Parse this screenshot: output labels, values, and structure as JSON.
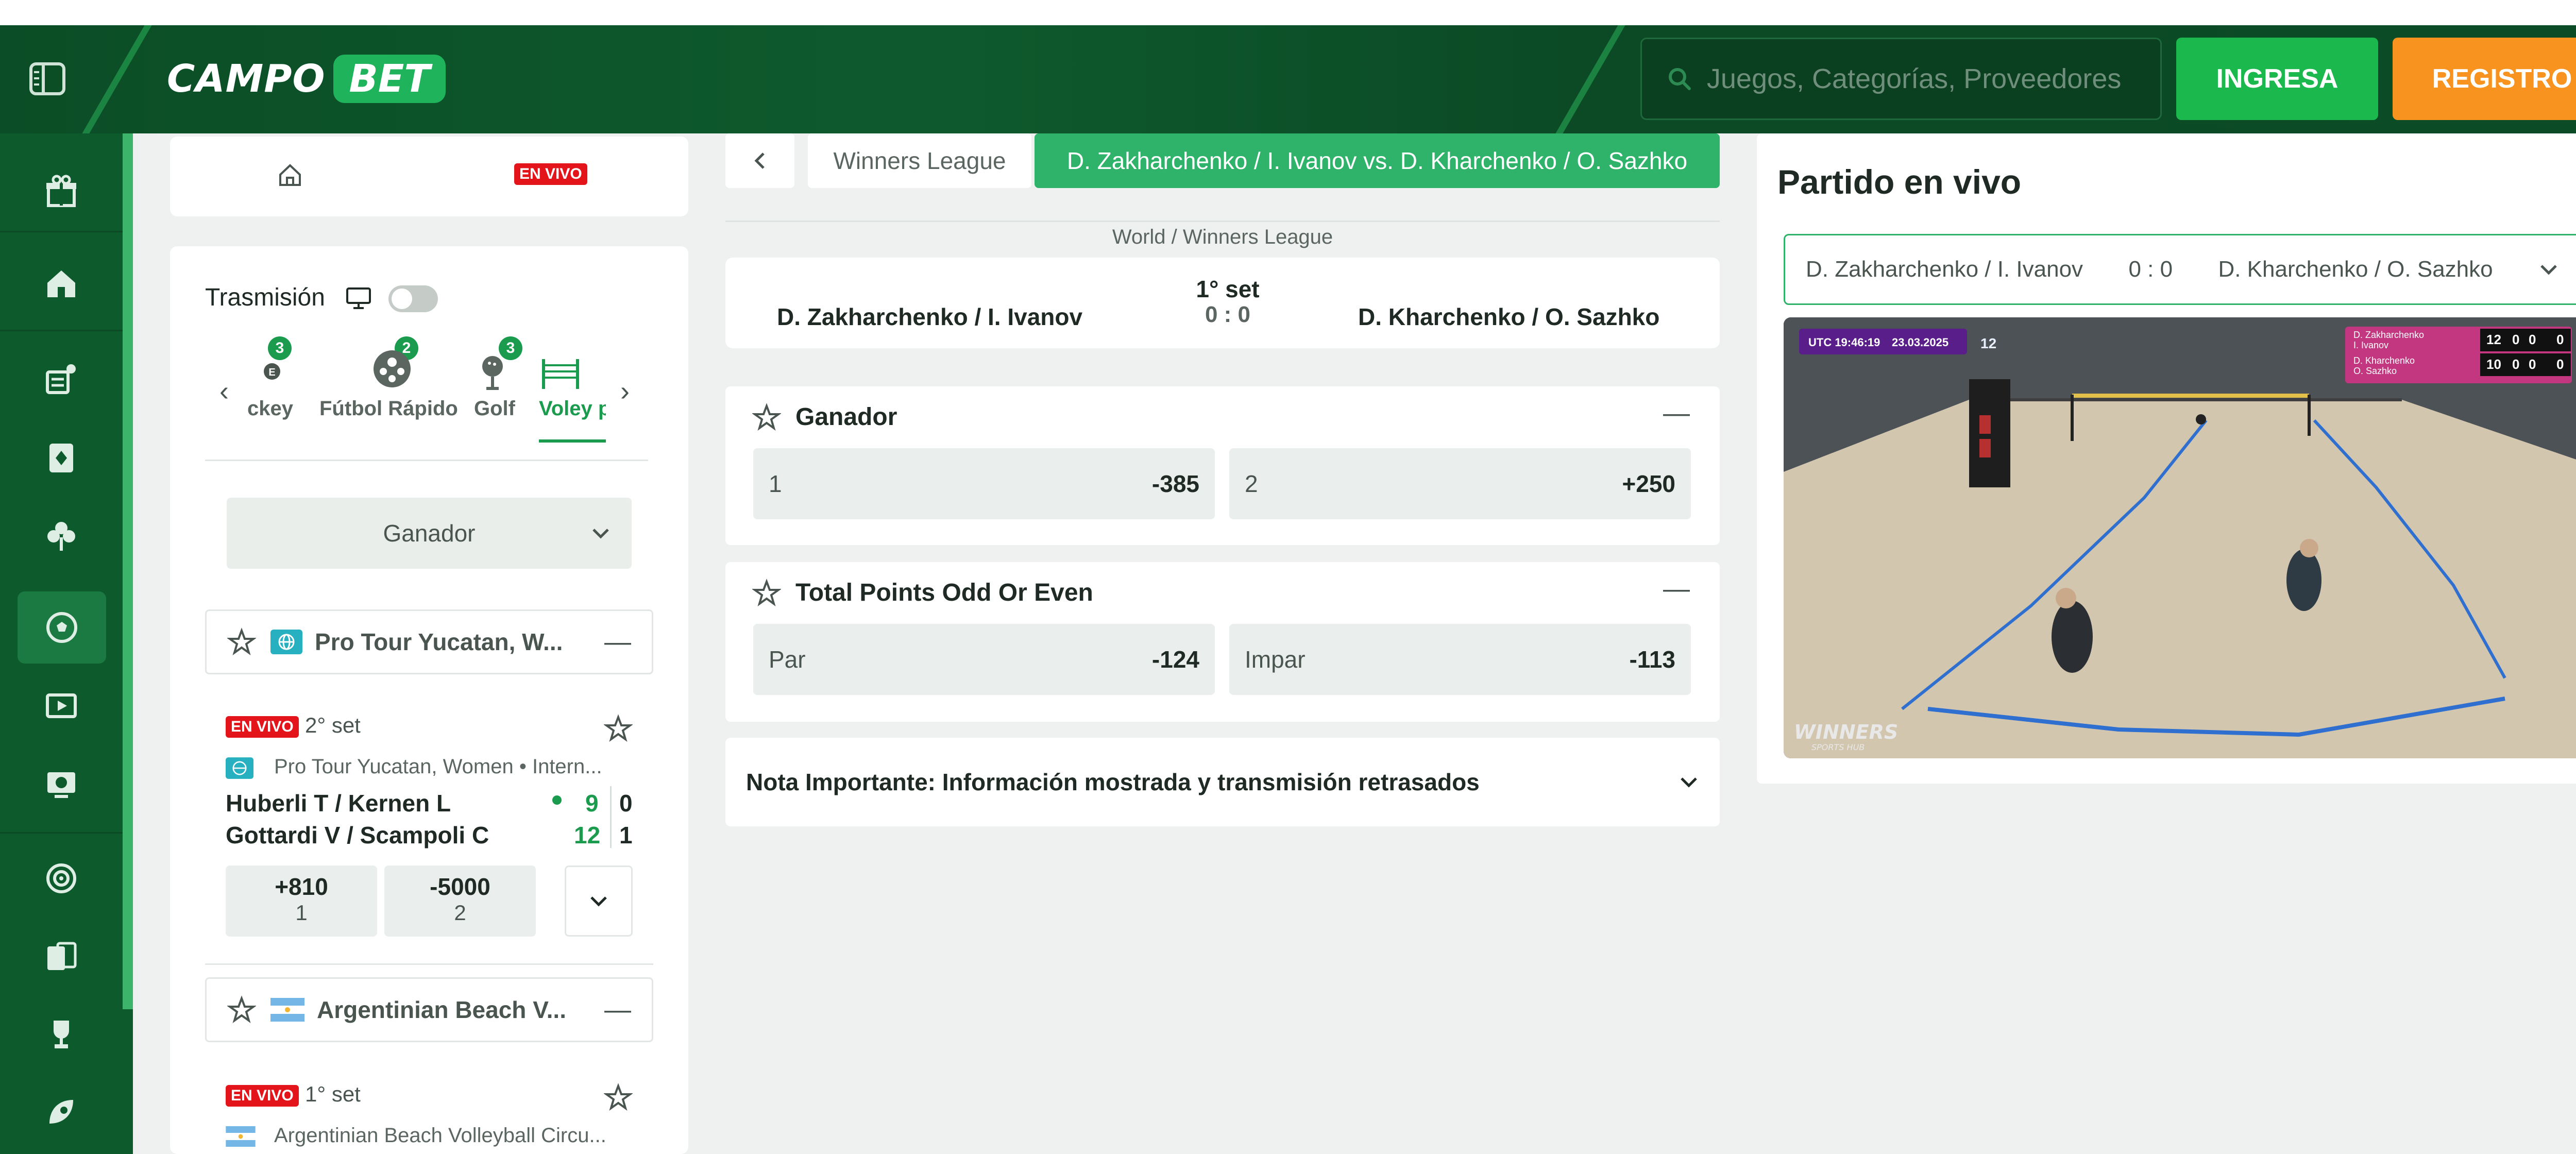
{
  "header": {
    "logo_left": "CAMPO",
    "logo_right": "BET",
    "search_placeholder": "Juegos, Categorías, Proveedores",
    "login_label": "INGRESA",
    "register_label": "REGISTRO"
  },
  "rail": {
    "icons": [
      "gift-icon",
      "home-icon",
      "sports-bet-icon",
      "casino-icon",
      "clover-icon",
      "soccer-ball-icon",
      "video-play-icon",
      "virtual-soccer-icon",
      "target-icon",
      "cards-icon",
      "trophy-icon",
      "rocket-icon"
    ]
  },
  "left": {
    "nav_live": "EN VIVO",
    "transmission_label": "Trasmisión",
    "sport_tabs": [
      {
        "label": "ckey",
        "count": "3"
      },
      {
        "label": "Fútbol Rápido",
        "count": "2"
      },
      {
        "label": "Golf",
        "count": "3"
      },
      {
        "label": "Voley p",
        "count": ""
      }
    ],
    "market_select": "Ganador",
    "leagues": [
      {
        "name": "Pro Tour Yucatan, W...",
        "events": [
          {
            "live": "EN VIVO",
            "period": "2° set",
            "subtitle": "Pro Tour Yucatan, Women • Intern...",
            "team1": "Huberli T / Kernen L",
            "team2": "Gottardi V / Scampoli C",
            "score1a": "9",
            "score1b": "0",
            "score2a": "12",
            "score2b": "1",
            "odds": [
              {
                "value": "+810",
                "label": "1"
              },
              {
                "value": "-5000",
                "label": "2"
              }
            ]
          }
        ]
      },
      {
        "name": "Argentinian Beach V...",
        "events": [
          {
            "live": "EN VIVO",
            "period": "1° set",
            "subtitle": "Argentinian Beach Volleyball Circu..."
          }
        ]
      }
    ]
  },
  "center": {
    "breadcrumb_league": "Winners League",
    "breadcrumb_match": "D. Zakharchenko / I. Ivanov vs. D. Kharchenko / O. Sazhko",
    "path": "World / Winners League",
    "home": "D. Zakharchenko / I. Ivanov",
    "away": "D. Kharchenko / O. Sazhko",
    "set": "1° set",
    "score": "0 : 0",
    "markets": [
      {
        "title": "Ganador",
        "selections": [
          {
            "name": "1",
            "odd": "-385"
          },
          {
            "name": "2",
            "odd": "+250"
          }
        ]
      },
      {
        "title": "Total Points Odd Or Even",
        "selections": [
          {
            "name": "Par",
            "odd": "-124"
          },
          {
            "name": "Impar",
            "odd": "-113"
          }
        ]
      }
    ],
    "note": "Nota Importante: Información mostrada y transmisión retrasados"
  },
  "live": {
    "title": "Partido en vivo",
    "match_home": "D. Zakharchenko / I. Ivanov",
    "match_score": "0 : 0",
    "match_away": "D. Kharchenko / O. Sazhko",
    "video": {
      "clock": "UTC 19:46:19",
      "date": "23.03.2025",
      "team1_a": "D. Zakharchenko",
      "team1_b": "I. Ivanov",
      "team2_a": "D. Kharchenko",
      "team2_b": "O. Sazhko",
      "t1_scores": [
        "12",
        "0",
        "0",
        "0"
      ],
      "t2_scores": [
        "10",
        "0",
        "0",
        "0"
      ],
      "watermark": "WINNERS",
      "watermark_sub": "SPORTS HUB",
      "court_number": "12"
    }
  },
  "colors": {
    "brand_green": "#0d5a2d",
    "accent_green": "#2fb36b",
    "cta_green": "#1ab84d",
    "cta_orange": "#f7931e",
    "live_red": "#e3151b"
  }
}
